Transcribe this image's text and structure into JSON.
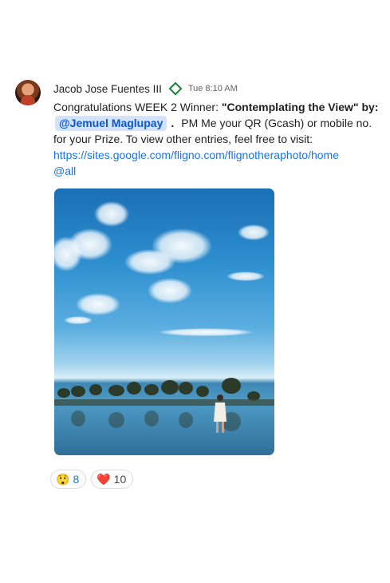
{
  "message": {
    "author": "Jacob Jose Fuentes III",
    "timestamp": "Tue 8:10 AM",
    "text_prefix": "Congratulations WEEK 2 Winner: ",
    "title_bold": "\"Contemplating the View\" by:",
    "mention": "@Jemuel Maglupay",
    "period": ".",
    "text_after_mention": "PM Me your QR (Gcash) or mobile no.",
    "line3": "for your Prize. To view other entries, feel free to visit:",
    "link_url": "https://sites.google.com/fligno.com/flignotheraphoto/home",
    "mention_all": "@all"
  },
  "reactions": [
    {
      "emoji": "😲",
      "count": "8"
    },
    {
      "emoji": "❤️",
      "count": "10"
    }
  ],
  "colors": {
    "link": "#1a73e8",
    "mention_bg": "#d3e3fd",
    "status_diamond": "#188038"
  },
  "icons": {
    "status": "diamond-outline-icon"
  }
}
